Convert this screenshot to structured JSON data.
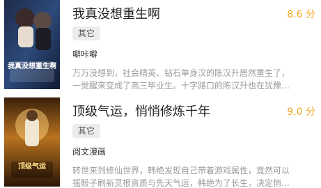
{
  "books": [
    {
      "title": "我真没想重生啊",
      "score": "8.6 分",
      "tag": "其它",
      "author": "噼咔噼",
      "desc_line1": "万万没想到，社会精英、钻石单身汉的陈汉升居然重生了，",
      "desc_line2": "一觉醒来变成了高三毕业生。十字路口的陈汉升也在犹豫…",
      "cover_text": "我真没想重生啊",
      "cover_icon": "manga-cover-icon",
      "accent_color": "#f5a623"
    },
    {
      "title": "顶级气运，悄悄修炼千年",
      "score": "9.0 分",
      "tag": "其它",
      "author": "阅文漫画",
      "desc_line1": "转世来到修仙世界，韩绝发现自己带着游戏属性，竟然可以",
      "desc_line2": "摇骰子刷新灵根资质与先天气运，韩绝为了长生，决定悄…",
      "cover_text": "顶级气运",
      "cover_icon": "manga-cover-icon",
      "accent_color": "#f5a623"
    }
  ]
}
